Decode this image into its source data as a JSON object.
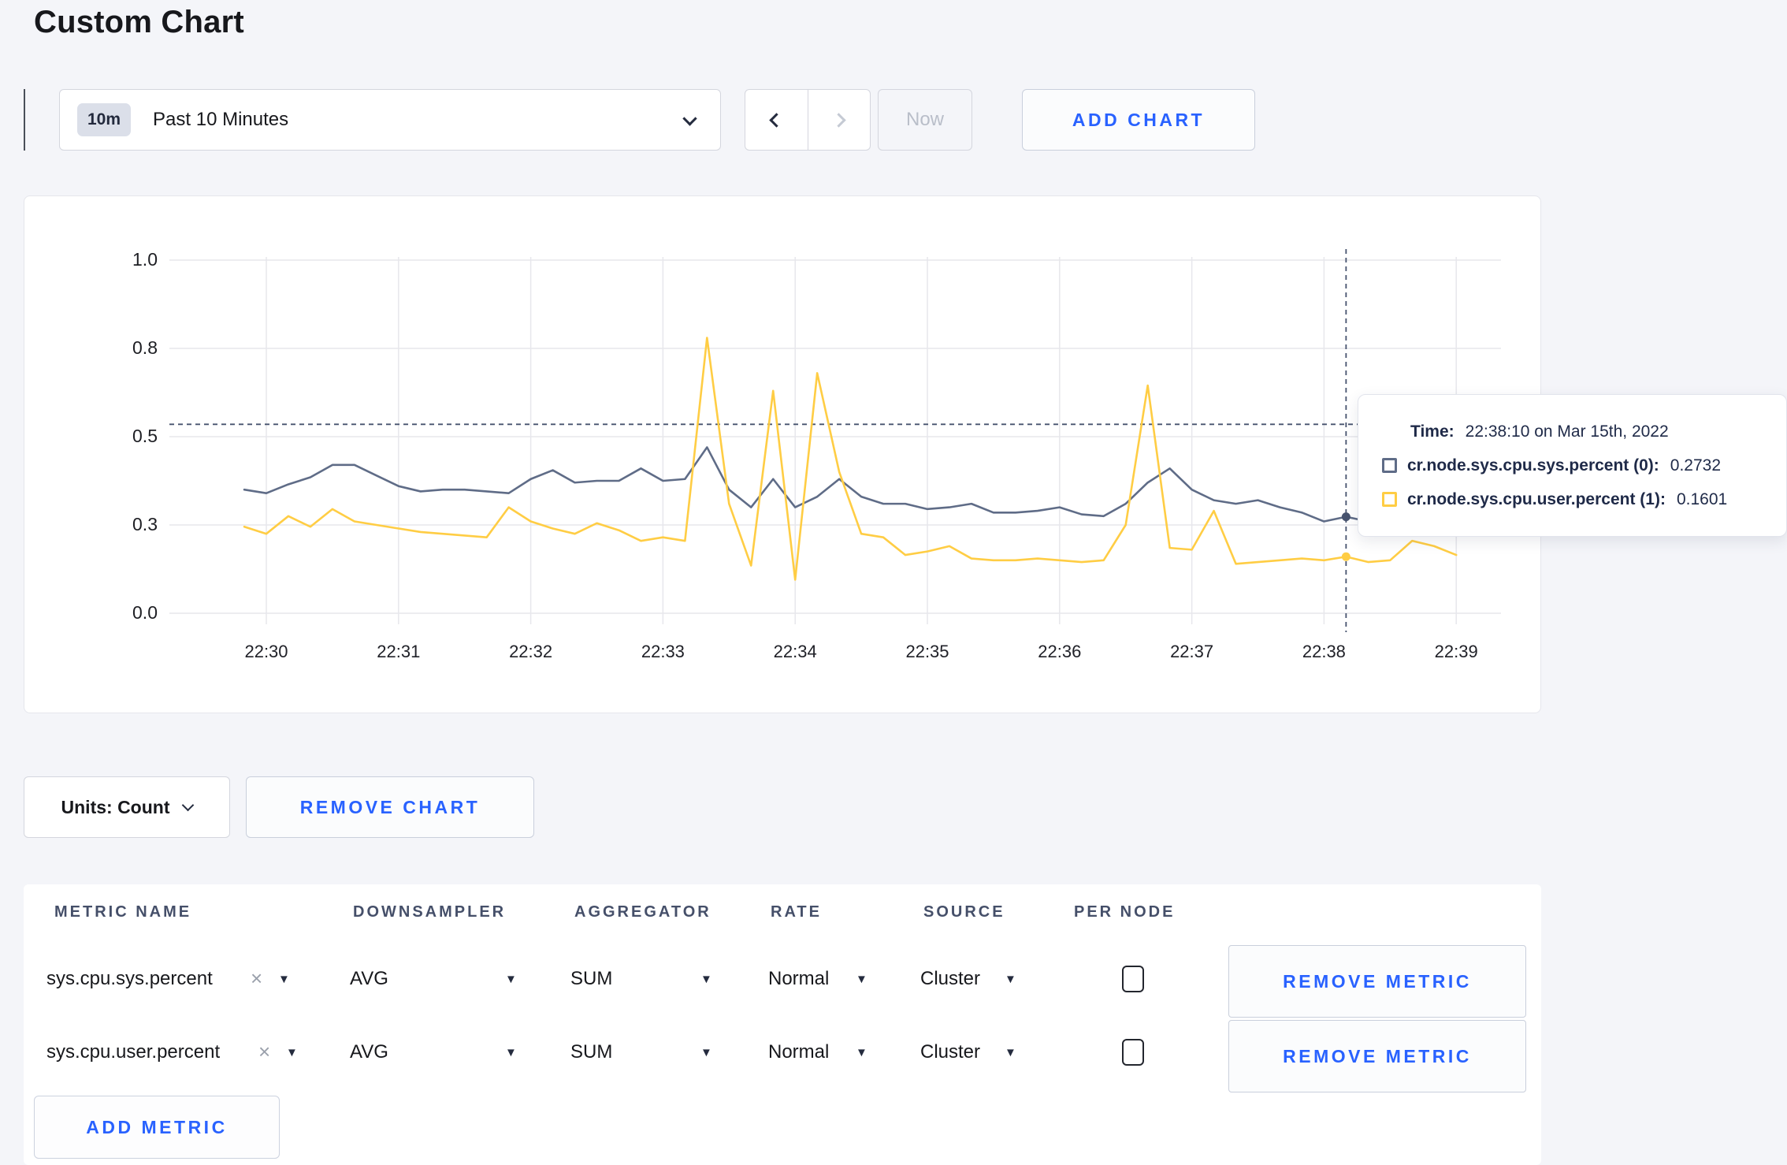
{
  "page": {
    "title": "Custom Chart",
    "background": "#f4f5f9",
    "accent_blue": "#2962ff"
  },
  "icons": {
    "dropdown_caret": "▼",
    "close": "×",
    "chevron_down": "⌄",
    "chevron_left": "‹",
    "chevron_right": "›"
  },
  "toolbar": {
    "time_badge": "10m",
    "time_label": "Past 10 Minutes",
    "now_label": "Now",
    "add_chart_label": "ADD CHART"
  },
  "chart_data": {
    "type": "line",
    "title": "",
    "xlabel": "",
    "ylabel": "",
    "grid": true,
    "legend": "none",
    "ylim": [
      0,
      1
    ],
    "x_start_time": "22:29:50",
    "x_interval_seconds": 10,
    "x_tick_labels": [
      "22:30",
      "22:31",
      "22:32",
      "22:33",
      "22:34",
      "22:35",
      "22:36",
      "22:37",
      "22:38",
      "22:39"
    ],
    "y_ticks": [
      {
        "value": 0,
        "label": "0.0"
      },
      {
        "value": 0.25,
        "label": "0.3"
      },
      {
        "value": 0.5,
        "label": "0.5"
      },
      {
        "value": 0.75,
        "label": "0.8"
      },
      {
        "value": 1.0,
        "label": "1.0"
      }
    ],
    "series": [
      {
        "name": "cr.node.sys.cpu.sys.percent",
        "color": "#5f6c87",
        "values": [
          0.35,
          0.34,
          0.365,
          0.385,
          0.42,
          0.42,
          0.39,
          0.36,
          0.345,
          0.35,
          0.35,
          0.345,
          0.34,
          0.38,
          0.405,
          0.37,
          0.375,
          0.375,
          0.41,
          0.375,
          0.38,
          0.47,
          0.35,
          0.3,
          0.38,
          0.3,
          0.33,
          0.38,
          0.33,
          0.31,
          0.31,
          0.295,
          0.3,
          0.31,
          0.285,
          0.285,
          0.29,
          0.3,
          0.28,
          0.275,
          0.31,
          0.37,
          0.41,
          0.35,
          0.32,
          0.31,
          0.32,
          0.3,
          0.285,
          0.26,
          0.2732,
          0.26,
          0.27,
          0.28,
          0.285,
          0.29
        ]
      },
      {
        "name": "cr.node.sys.cpu.user.percent",
        "color": "#ffcd44",
        "values": [
          0.245,
          0.225,
          0.275,
          0.245,
          0.295,
          0.26,
          0.25,
          0.24,
          0.23,
          0.225,
          0.22,
          0.215,
          0.3,
          0.26,
          0.24,
          0.225,
          0.255,
          0.235,
          0.205,
          0.215,
          0.205,
          0.78,
          0.31,
          0.135,
          0.63,
          0.095,
          0.68,
          0.4,
          0.225,
          0.215,
          0.165,
          0.175,
          0.19,
          0.155,
          0.15,
          0.15,
          0.155,
          0.15,
          0.145,
          0.15,
          0.25,
          0.645,
          0.185,
          0.18,
          0.29,
          0.14,
          0.145,
          0.15,
          0.155,
          0.15,
          0.1601,
          0.145,
          0.15,
          0.205,
          0.19,
          0.165
        ]
      }
    ],
    "crosshair": {
      "time": "22:38:10",
      "x_index": 50,
      "h_line_value": 0.535
    },
    "tooltip": {
      "time_label": "Time:",
      "time_value": "22:38:10 on Mar 15th, 2022",
      "rows": [
        {
          "label": "cr.node.sys.cpu.sys.percent (0):",
          "value": "0.2732"
        },
        {
          "label": "cr.node.sys.cpu.user.percent (1):",
          "value": "0.1601"
        }
      ]
    }
  },
  "chart_footer": {
    "units_label": "Units: Count",
    "remove_chart_label": "REMOVE CHART"
  },
  "metrics_table": {
    "headers": [
      "METRIC NAME",
      "DOWNSAMPLER",
      "AGGREGATOR",
      "RATE",
      "SOURCE",
      "PER NODE"
    ],
    "rows": [
      {
        "metric": "sys.cpu.sys.percent",
        "downsampler": "AVG",
        "aggregator": "SUM",
        "rate": "Normal",
        "source": "Cluster",
        "per_node_checked": false,
        "remove_label": "REMOVE METRIC"
      },
      {
        "metric": "sys.cpu.user.percent",
        "downsampler": "AVG",
        "aggregator": "SUM",
        "rate": "Normal",
        "source": "Cluster",
        "per_node_checked": false,
        "remove_label": "REMOVE METRIC"
      }
    ],
    "add_metric_label": "ADD METRIC"
  }
}
